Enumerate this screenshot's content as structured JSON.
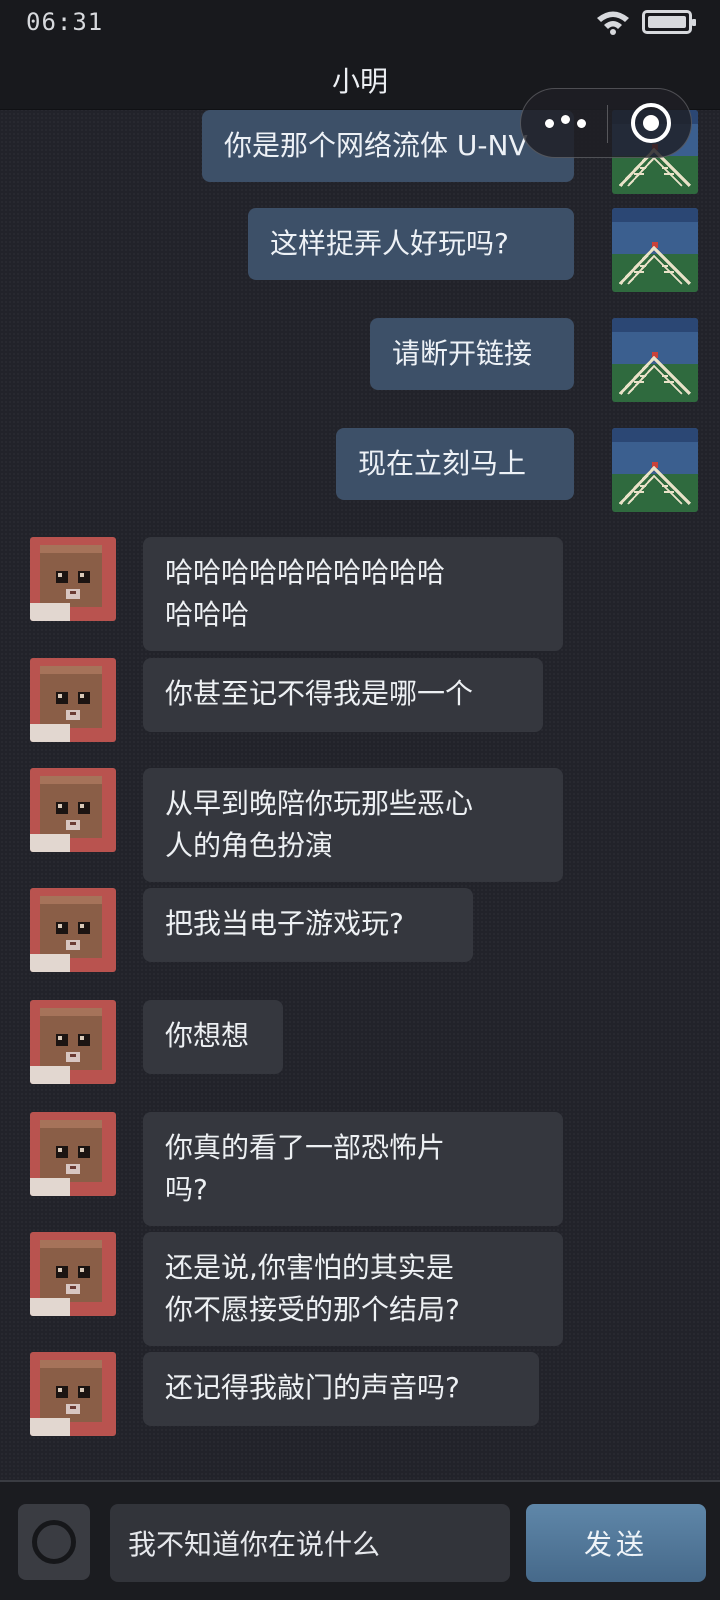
{
  "status_bar": {
    "time": "06:31",
    "wifi_icon": "wifi-icon",
    "battery_icon": "battery-icon"
  },
  "header": {
    "title": "小明",
    "more_icon": "more-dots-icon",
    "close_icon": "target-icon"
  },
  "messages": [
    {
      "side": "sent",
      "text": "你是那个网络流体 U-NV"
    },
    {
      "side": "sent",
      "text": "这样捉弄人好玩吗?"
    },
    {
      "side": "sent",
      "text": "请断开链接"
    },
    {
      "side": "sent",
      "text": "现在立刻马上"
    },
    {
      "side": "recv",
      "text": "哈哈哈哈哈哈哈哈哈哈\n哈哈哈"
    },
    {
      "side": "recv",
      "text": "你甚至记不得我是哪一个"
    },
    {
      "side": "recv",
      "text": "从早到晚陪你玩那些恶心\n人的角色扮演"
    },
    {
      "side": "recv",
      "text": "把我当电子游戏玩?"
    },
    {
      "side": "recv",
      "text": "你想想"
    },
    {
      "side": "recv",
      "text": "你真的看了一部恐怖片\n吗?"
    },
    {
      "side": "recv",
      "text": "还是说,你害怕的其实是\n你不愿接受的那个结局?"
    },
    {
      "side": "recv",
      "text": "还记得我敲门的声音吗?"
    }
  ],
  "input_bar": {
    "camera_icon": "camera-icon",
    "input_value": "我不知道你在说什么",
    "send_label": "发送"
  },
  "colors": {
    "background": "#22232a",
    "sent_bubble": "#3d5068",
    "received_bubble": "#35373e",
    "send_button": "#5277a0"
  }
}
